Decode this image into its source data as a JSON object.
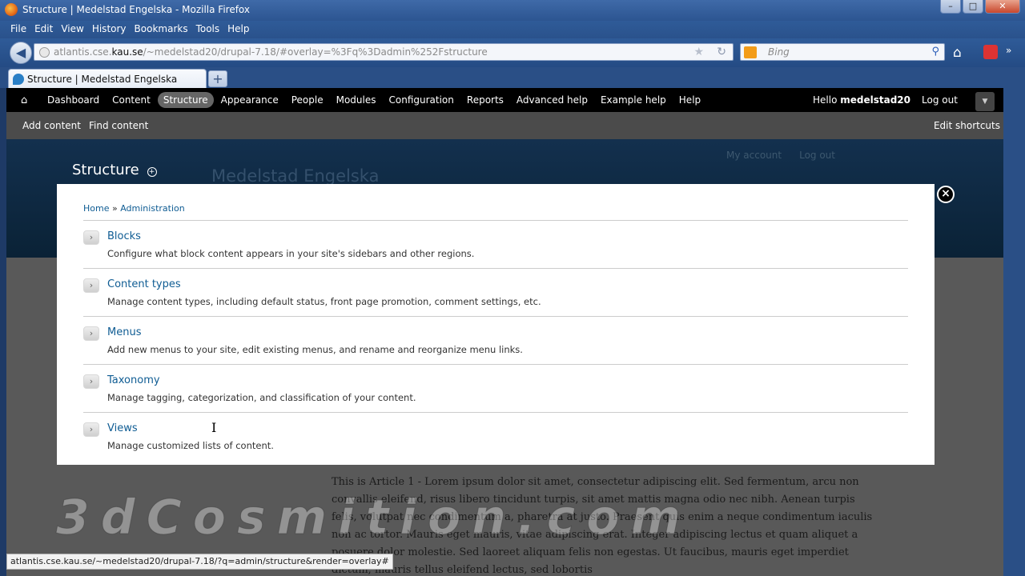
{
  "window": {
    "title": "Structure | Medelstad Engelska - Mozilla Firefox"
  },
  "menubar": [
    "File",
    "Edit",
    "View",
    "History",
    "Bookmarks",
    "Tools",
    "Help"
  ],
  "navbar": {
    "url_prefix": "atlantis.cse.",
    "url_domain": "kau.se",
    "url_rest": "/~medelstad20/drupal-7.18/#overlay=%3Fq%3Dadmin%252Fstructure",
    "search_placeholder": "Bing"
  },
  "tab": {
    "title": "Structure | Medelstad Engelska",
    "new_tab": "+"
  },
  "toolbar": {
    "items": [
      "Dashboard",
      "Content",
      "Structure",
      "Appearance",
      "People",
      "Modules",
      "Configuration",
      "Reports",
      "Advanced help",
      "Example help",
      "Help"
    ],
    "active": "Structure",
    "hello": "Hello ",
    "username": "medelstad20",
    "logout": "Log out"
  },
  "shortcuts": {
    "add_content": "Add content",
    "find_content": "Find content",
    "edit": "Edit shortcuts"
  },
  "site": {
    "name": "Medelstad Engelska",
    "my_account": "My account",
    "log_out": "Log out",
    "page_title": "Structure"
  },
  "overlay": {
    "breadcrumb": {
      "home": "Home",
      "sep": " » ",
      "admin": "Administration"
    },
    "items": [
      {
        "title": "Blocks",
        "desc": "Configure what block content appears in your site's sidebars and other regions."
      },
      {
        "title": "Content types",
        "desc": "Manage content types, including default status, front page promotion, comment settings, etc."
      },
      {
        "title": "Menus",
        "desc": "Add new menus to your site, edit existing menus, and rename and reorganize menu links."
      },
      {
        "title": "Taxonomy",
        "desc": "Manage tagging, categorization, and classification of your content."
      },
      {
        "title": "Views",
        "desc": "Manage customized lists of content."
      }
    ]
  },
  "article": {
    "text": "This is Article 1 - Lorem ipsum dolor sit amet, consectetur adipiscing elit. Sed fermentum, arcu non convallis eleifend, risus libero tincidunt turpis, sit amet mattis magna odio nec nibh. Aenean turpis felis, volutpat nec condimentum a, pharetra at justo. Praesent quis enim a neque condimentum iaculis non ac tortor. Mauris eget mauris, vitae adipiscing erat. Integer adipiscing lectus et quam aliquet a posuere dolor molestie. Sed laoreet aliquam felis non egestas. Ut faucibus, mauris eget imperdiet dictum, mauris tellus eleifend lectus, sed lobortis"
  },
  "watermark": "3dCosmition.com",
  "statusbar": "atlantis.cse.kau.se/~medelstad20/drupal-7.18/?q=admin/structure&render=overlay#"
}
